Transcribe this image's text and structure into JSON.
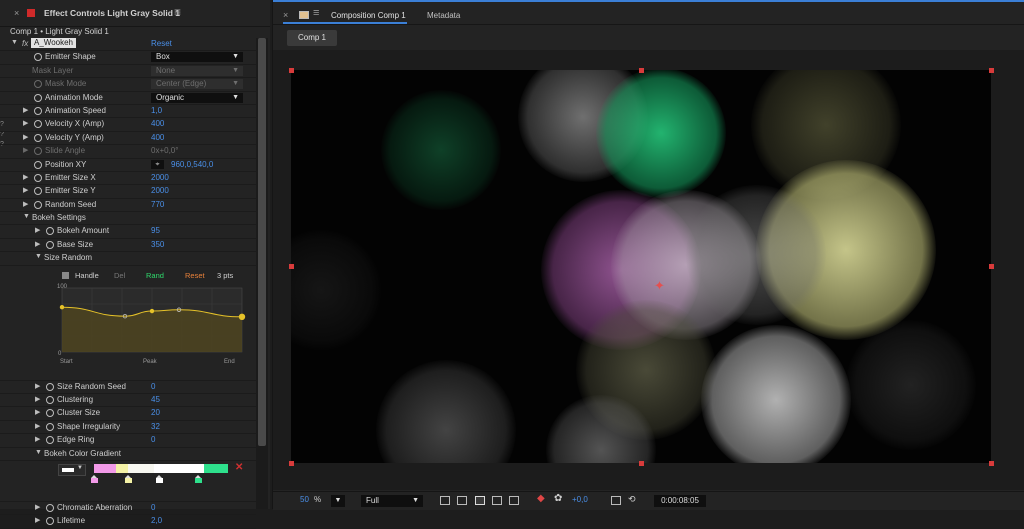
{
  "left_panel": {
    "tab_title": "Effect Controls Light Gray Solid 1",
    "subheader": "Comp 1 • Light Gray Solid 1",
    "fx_label": "fx",
    "effect_name": "A_Wookeh",
    "reset_label": "Reset",
    "edge_glyphs": [
      "?",
      "?",
      "?"
    ],
    "properties": {
      "emitter_shape": {
        "label": "Emitter Shape",
        "value": "Box"
      },
      "mask_layer": {
        "label": "Mask Layer",
        "value": "None"
      },
      "mask_mode": {
        "label": "Mask Mode",
        "value": "Center (Edge)"
      },
      "animation_mode": {
        "label": "Animation Mode",
        "value": "Organic"
      },
      "animation_speed": {
        "label": "Animation Speed",
        "value": "1,0"
      },
      "velocity_x": {
        "label": "Velocity X (Amp)",
        "value": "400"
      },
      "velocity_y": {
        "label": "Velocity Y (Amp)",
        "value": "400"
      },
      "slide_angle": {
        "label": "Slide Angle",
        "value": "0x+0,0°"
      },
      "position_xy": {
        "label": "Position XY",
        "value": "960,0,540,0",
        "target_icon": "crosshair-icon"
      },
      "emitter_size_x": {
        "label": "Emitter Size X",
        "value": "2000"
      },
      "emitter_size_y": {
        "label": "Emitter Size Y",
        "value": "2000"
      },
      "random_seed": {
        "label": "Random Seed",
        "value": "770"
      },
      "bokeh_settings": {
        "label": "Bokeh Settings"
      },
      "bokeh_amount": {
        "label": "Bokeh Amount",
        "value": "95"
      },
      "base_size": {
        "label": "Base Size",
        "value": "350"
      },
      "size_random": {
        "label": "Size Random"
      },
      "size_random_seed": {
        "label": "Size Random Seed",
        "value": "0"
      },
      "clustering": {
        "label": "Clustering",
        "value": "45"
      },
      "cluster_size": {
        "label": "Cluster Size",
        "value": "20"
      },
      "shape_irregularity": {
        "label": "Shape Irregularity",
        "value": "32"
      },
      "edge_ring": {
        "label": "Edge Ring",
        "value": "0"
      },
      "bokeh_color_gradient": {
        "label": "Bokeh Color Gradient"
      },
      "chromatic_aberration": {
        "label": "Chromatic Aberration",
        "value": "0"
      },
      "lifetime": {
        "label": "Lifetime",
        "value": "2,0"
      }
    },
    "curve_editor": {
      "handle_label": "Handle",
      "del_label": "Del",
      "rand_label": "Rand",
      "reset_label": "Reset",
      "points_label": "3 pts",
      "y_max_label": "100",
      "y_min_label": "0",
      "x_labels": {
        "start": "Start",
        "peak": "Peak",
        "end": "End"
      },
      "curve_color": "#e6c229",
      "fill_color": "#4e4420",
      "points": [
        {
          "t": 0.0,
          "v": 0.7
        },
        {
          "t": 0.35,
          "v": 0.56
        },
        {
          "t": 0.5,
          "v": 0.64
        },
        {
          "t": 0.65,
          "v": 0.66
        },
        {
          "t": 1.0,
          "v": 0.55
        }
      ]
    },
    "gradient": {
      "delete_label": "✕",
      "segments": [
        "#f29ae8",
        "#f4f2a6",
        "#f7f7f0",
        "#ffffff",
        "#2ee08c"
      ],
      "stops": [
        "#f29ae8",
        "#f4f2a6",
        "#ffffff",
        "#2ee08c"
      ]
    }
  },
  "right_panel": {
    "comp_tab_label": "Composition Comp 1",
    "metadata_tab_label": "Metadata",
    "comp_subtab_label": "Comp 1",
    "accent_color": "#3b7fd6",
    "bottom_bar": {
      "zoom_value": "50",
      "zoom_unit": "%",
      "resolution": "Full",
      "exposure": "+0,0",
      "timecode": "0:00:08:05"
    }
  }
}
